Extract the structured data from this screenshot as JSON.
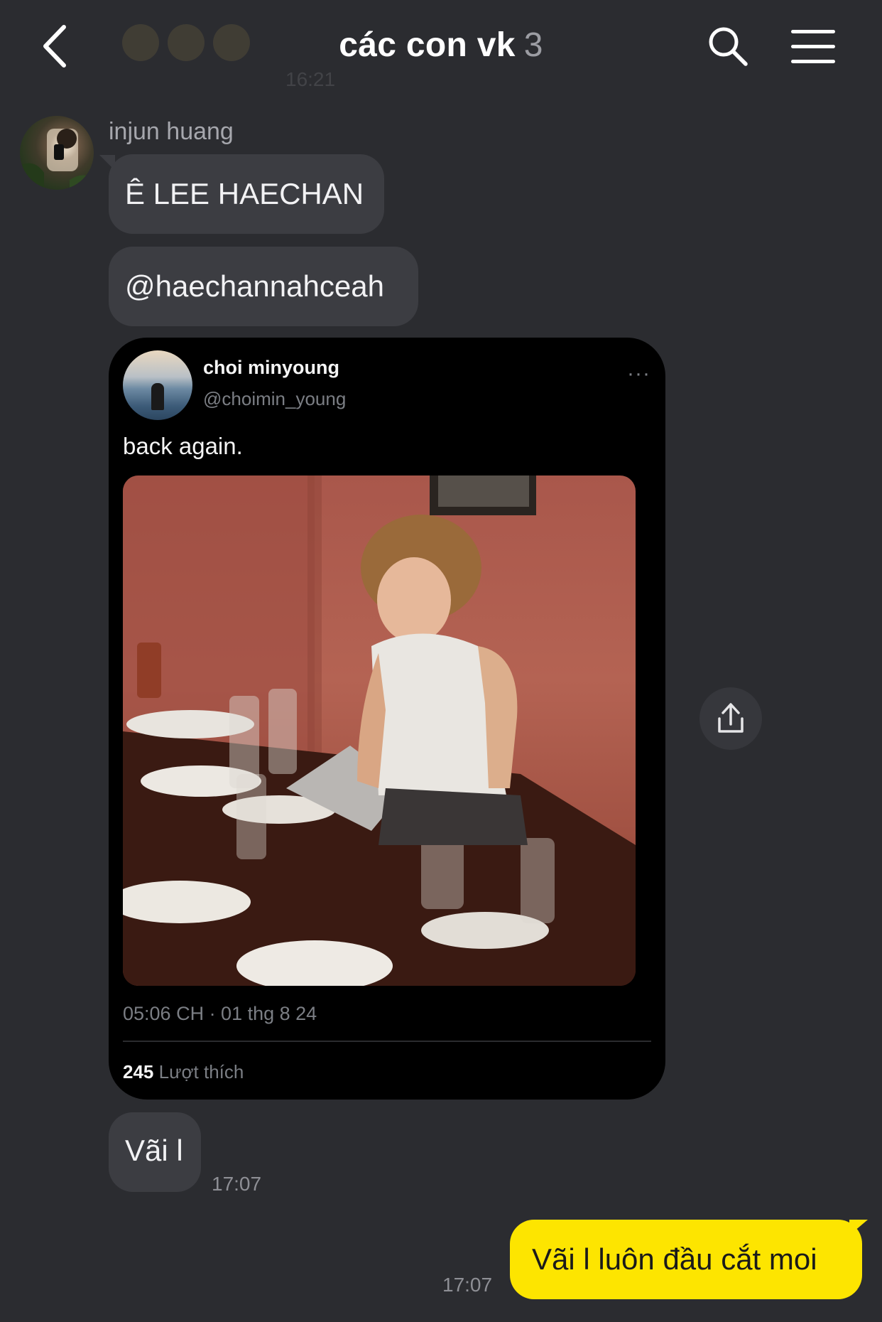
{
  "header": {
    "title": "các con vk",
    "member_count": "3",
    "ghost_time": "16:21",
    "back_icon": "chevron-left-icon",
    "search_icon": "search-icon",
    "menu_icon": "hamburger-menu-icon"
  },
  "messages": {
    "sender_name": "injun huang",
    "m1": "Ê LEE HAECHAN",
    "m2": "@haechannahceah",
    "m3": "Vãi l",
    "m3_time": "17:07",
    "m4": "Vãi l luôn đầu cắt moi",
    "m4_time": "17:07"
  },
  "tweet": {
    "name": "choi minyoung",
    "handle": "@choimin_young",
    "more": "···",
    "text": "back again.",
    "timestamp": "05:06 CH · 01 thg 8 24",
    "likes_count": "245",
    "likes_label": "Lượt thích"
  },
  "colors": {
    "background": "#2b2c30",
    "incoming_bubble": "#3c3d42",
    "outgoing_bubble": "#fde500",
    "card": "#000000"
  }
}
